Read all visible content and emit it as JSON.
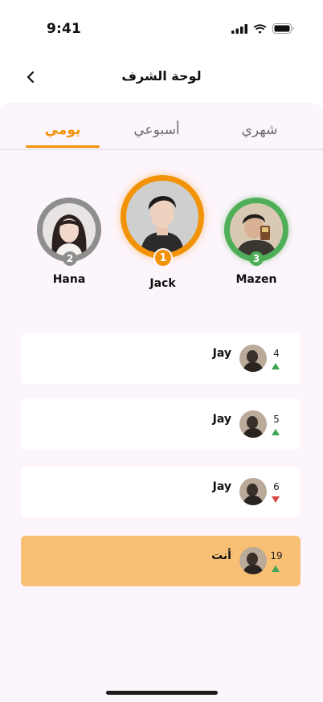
{
  "status_bar": {
    "time": "9:41"
  },
  "nav": {
    "title": "لوحة الشرف"
  },
  "tabs": [
    {
      "label": "شهري"
    },
    {
      "label": "أسبوعي"
    },
    {
      "label": "يومي"
    }
  ],
  "podium": {
    "first": {
      "name": "Jack",
      "rank": "1"
    },
    "second": {
      "name": "Hana",
      "rank": "2"
    },
    "third": {
      "name": "Mazen",
      "rank": "3"
    }
  },
  "leaderboard": [
    {
      "name": "Jay",
      "rank": "4",
      "trend": "up"
    },
    {
      "name": "Jay",
      "rank": "5",
      "trend": "up"
    },
    {
      "name": "Jay",
      "rank": "6",
      "trend": "down"
    },
    {
      "name": "أنت",
      "rank": "19",
      "trend": "up"
    }
  ],
  "colors": {
    "accent": "#f29307",
    "first_ring": "#f29307",
    "second_ring": "#8e8e8e",
    "third_ring": "#4fae58",
    "current_user_row": "#f8c074",
    "trend_up": "#3fa551",
    "trend_down": "#d84343",
    "panel_background": "#fdf5fc"
  }
}
